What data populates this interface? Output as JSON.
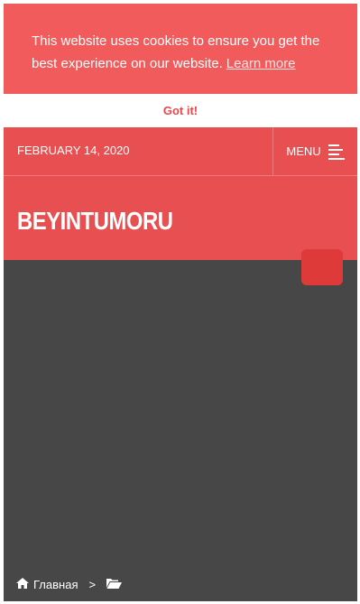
{
  "cookie_banner": {
    "message": "This website uses cookies to ensure you get the best experience on our website.",
    "learn_more": "Learn more",
    "accept": "Got it!"
  },
  "header": {
    "date": "FEBRUARY 14, 2020",
    "menu_label": "MENU",
    "menu_icon": "hamburger-icon",
    "site_title": "BEYINTUMORU"
  },
  "breadcrumb": {
    "home_icon": "home-icon",
    "home_label": "Главная",
    "separator": ">",
    "folder_icon": "folder-open-icon"
  },
  "colors": {
    "banner": "#f25b5b",
    "header": "#e84f50",
    "accent_button": "#de3a3a",
    "content_bg": "#474747"
  }
}
